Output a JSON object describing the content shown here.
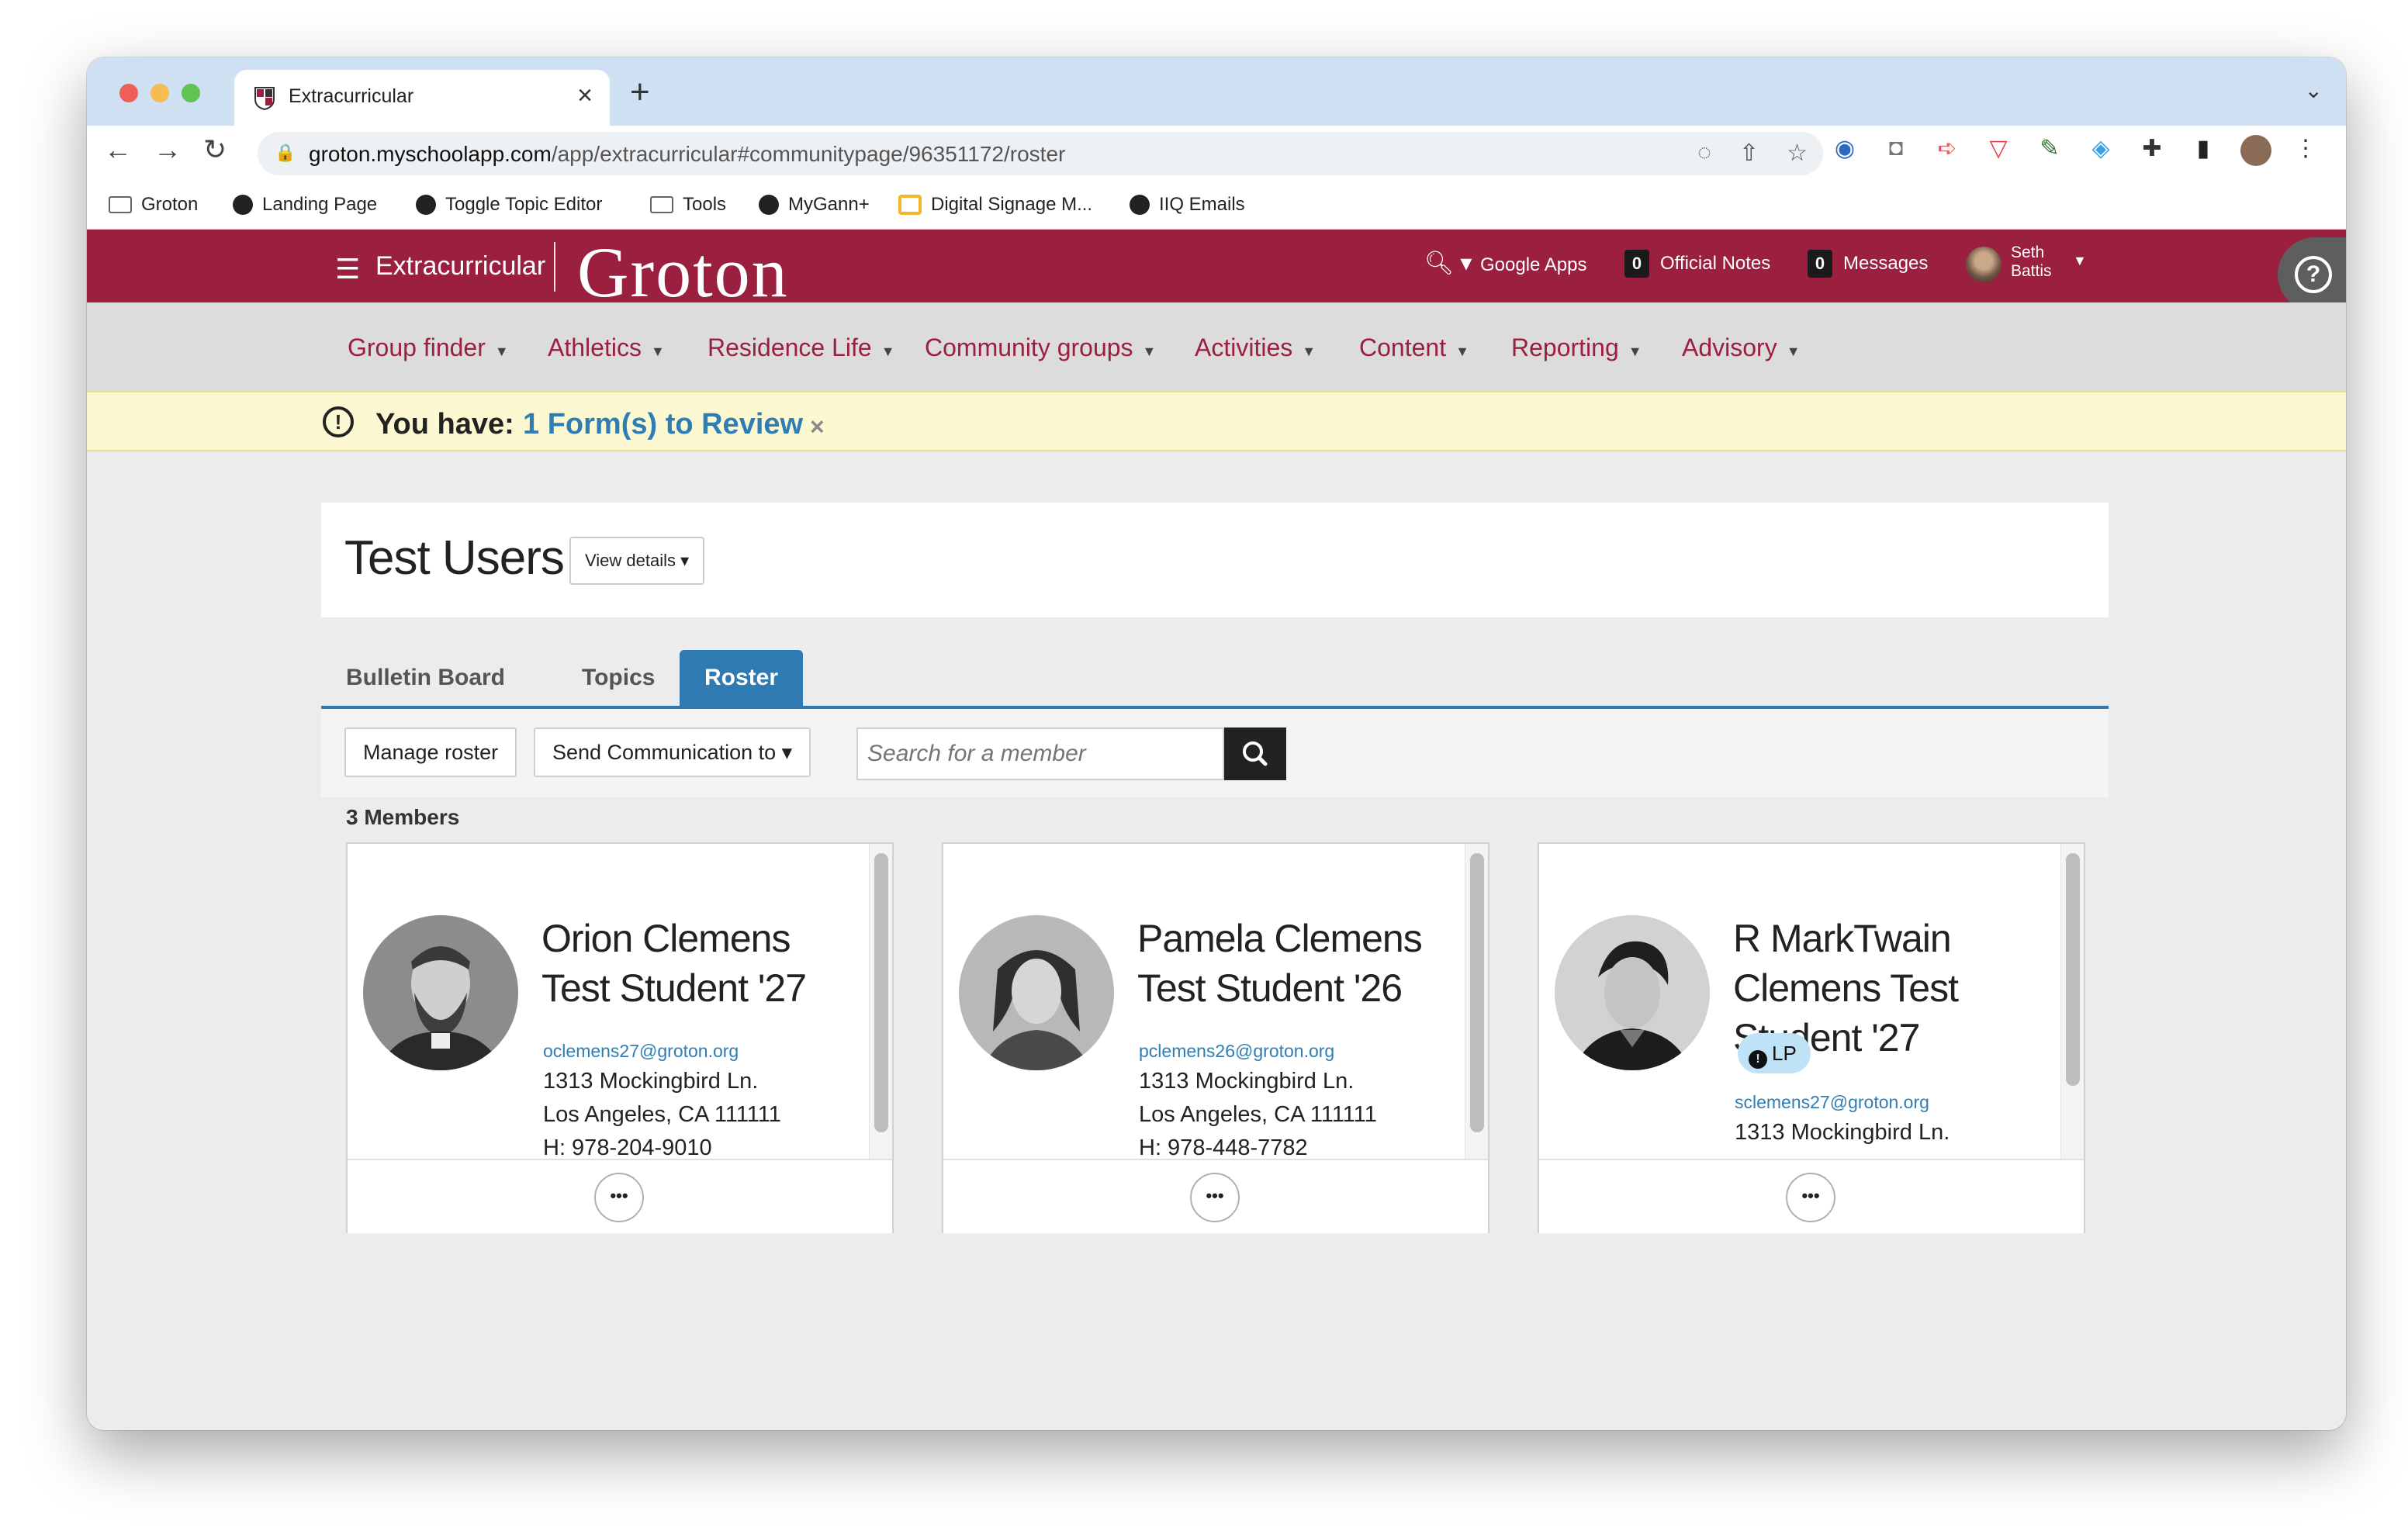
{
  "browser": {
    "tab_title": "Extracurricular",
    "url_host": "groton.myschoolapp.com",
    "url_path": "/app/extracurricular#communitypage/96351172/roster",
    "bookmarks": [
      "Groton",
      "Landing Page",
      "Toggle Topic Editor",
      "Tools",
      "MyGann+",
      "Digital Signage M...",
      "IIQ Emails"
    ]
  },
  "header": {
    "app_name": "Extracurricular",
    "logo": "Groton",
    "google_apps": "Google Apps",
    "notes_count": "0",
    "notes_label": "Official Notes",
    "messages_count": "0",
    "messages_label": "Messages",
    "user_first": "Seth",
    "user_last": "Battis",
    "help_icon": "question-circle-icon"
  },
  "subnav": [
    "Group finder",
    "Athletics",
    "Residence Life",
    "Community groups",
    "Activities",
    "Content",
    "Reporting",
    "Advisory"
  ],
  "alert": {
    "prefix": "You have:",
    "link": "1 Form(s) to Review",
    "close": "×"
  },
  "page": {
    "title": "Test Users",
    "view_details": "View details"
  },
  "tabs": [
    "Bulletin Board",
    "Topics",
    "Roster"
  ],
  "active_tab": "Roster",
  "actions": {
    "manage_roster": "Manage roster",
    "send_communication": "Send Communication to",
    "search_placeholder": "Search for a member"
  },
  "member_count": "3 Members",
  "members": [
    {
      "name": "Orion Clemens Test Student '27",
      "email": "oclemens27@groton.org",
      "address1": "1313 Mockingbird Ln.",
      "address2": "Los Angeles, CA 111111",
      "phone": "H: 978-204-9010"
    },
    {
      "name": "Pamela Clemens Test Student '26",
      "email": "pclemens26@groton.org",
      "address1": "1313 Mockingbird Ln.",
      "address2": "Los Angeles, CA 111111",
      "phone": "H: 978-448-7782"
    },
    {
      "name": "R MarkTwain Clemens Test Student '27",
      "badge": "LP",
      "email": "sclemens27@groton.org",
      "address1": "1313 Mockingbird Ln."
    }
  ],
  "more_label": "•••",
  "colors": {
    "brand": "#9b1f3e",
    "tab_active": "#2f7ab0",
    "link": "#2e7eb5",
    "alert_bg": "#fcf8d2"
  }
}
